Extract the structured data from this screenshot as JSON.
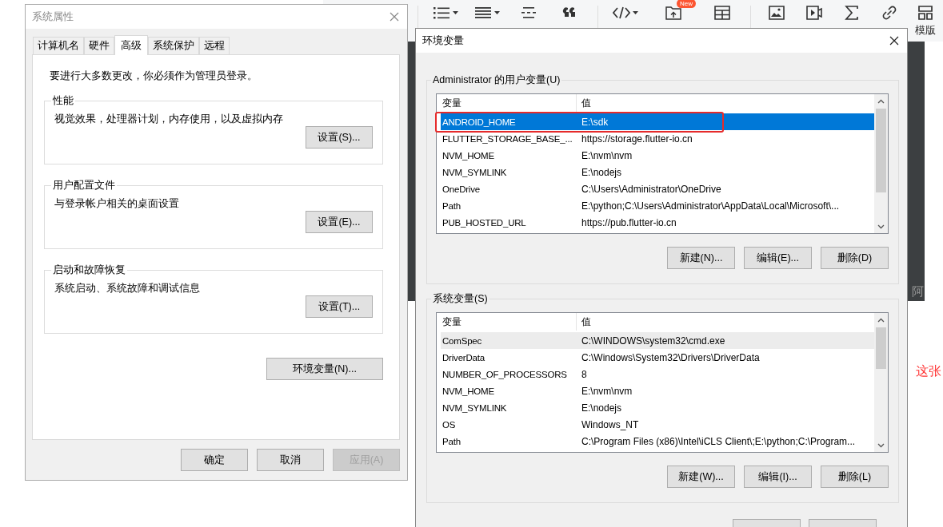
{
  "editor_toolbar": {
    "tools": [
      {
        "kind": "list",
        "dropdown": true,
        "divider_before": true
      },
      {
        "kind": "align",
        "dropdown": true,
        "divider_before": false
      },
      {
        "kind": "rule",
        "dropdown": false,
        "divider_before": false
      },
      {
        "kind": "quote",
        "dropdown": false,
        "divider_before": false
      },
      {
        "kind": "code",
        "dropdown": true,
        "divider_before": true
      },
      {
        "kind": "upload",
        "dropdown": false,
        "divider_before": false,
        "badge": "New"
      },
      {
        "kind": "table",
        "dropdown": false,
        "divider_before": false
      },
      {
        "kind": "image",
        "dropdown": false,
        "divider_before": true
      },
      {
        "kind": "video",
        "dropdown": false,
        "divider_before": false
      },
      {
        "kind": "formula",
        "dropdown": false,
        "divider_before": false
      },
      {
        "kind": "link",
        "dropdown": false,
        "divider_before": false
      },
      {
        "kind": "template",
        "dropdown": false,
        "divider_before": false,
        "label": "模版"
      }
    ]
  },
  "article": {
    "image_fragment": "阿",
    "text_fragment": "这张"
  },
  "system_properties": {
    "title": "系统属性",
    "tabs": [
      {
        "label": "计算机名",
        "selected": false
      },
      {
        "label": "硬件",
        "selected": false
      },
      {
        "label": "高级",
        "selected": true
      },
      {
        "label": "系统保护",
        "selected": false
      },
      {
        "label": "远程",
        "selected": false
      }
    ],
    "notice": "要进行大多数更改，你必须作为管理员登录。",
    "groups": [
      {
        "title": "性能",
        "description": "视觉效果，处理器计划，内存使用，以及虚拟内存",
        "button": "设置(S)..."
      },
      {
        "title": "用户配置文件",
        "description": "与登录帐户相关的桌面设置",
        "button": "设置(E)..."
      },
      {
        "title": "启动和故障恢复",
        "description": "系统启动、系统故障和调试信息",
        "button": "设置(T)..."
      }
    ],
    "env_button": "环境变量(N)...",
    "buttons": [
      {
        "label": "确定",
        "disabled": false
      },
      {
        "label": "取消",
        "disabled": false
      },
      {
        "label": "应用(A)",
        "disabled": true
      }
    ]
  },
  "environment_variables": {
    "title": "环境变量",
    "sections": [
      {
        "title": "Administrator 的用户变量(U)",
        "columns": [
          "变量",
          "值"
        ],
        "rows": [
          {
            "name": "ANDROID_HOME",
            "value": "E:\\sdk",
            "selected": true,
            "hovered": false,
            "annotated": true
          },
          {
            "name": "FLUTTER_STORAGE_BASE_...",
            "value": "https://storage.flutter-io.cn",
            "selected": false,
            "hovered": false,
            "annotated": false
          },
          {
            "name": "NVM_HOME",
            "value": "E:\\nvm\\nvm",
            "selected": false,
            "hovered": false,
            "annotated": false
          },
          {
            "name": "NVM_SYMLINK",
            "value": "E:\\nodejs",
            "selected": false,
            "hovered": false,
            "annotated": false
          },
          {
            "name": "OneDrive",
            "value": "C:\\Users\\Administrator\\OneDrive",
            "selected": false,
            "hovered": false,
            "annotated": false
          },
          {
            "name": "Path",
            "value": "E:\\python;C:\\Users\\Administrator\\AppData\\Local\\Microsoft\\...",
            "selected": false,
            "hovered": false,
            "annotated": false
          },
          {
            "name": "PUB_HOSTED_URL",
            "value": "https://pub.flutter-io.cn",
            "selected": false,
            "hovered": false,
            "annotated": false
          }
        ],
        "buttons": [
          "新建(N)...",
          "编辑(E)...",
          "删除(D)"
        ]
      },
      {
        "title": "系统变量(S)",
        "columns": [
          "变量",
          "值"
        ],
        "rows": [
          {
            "name": "ComSpec",
            "value": "C:\\WINDOWS\\system32\\cmd.exe",
            "selected": false,
            "hovered": true,
            "annotated": false
          },
          {
            "name": "DriverData",
            "value": "C:\\Windows\\System32\\Drivers\\DriverData",
            "selected": false,
            "hovered": false,
            "annotated": false
          },
          {
            "name": "NUMBER_OF_PROCESSORS",
            "value": "8",
            "selected": false,
            "hovered": false,
            "annotated": false
          },
          {
            "name": "NVM_HOME",
            "value": "E:\\nvm\\nvm",
            "selected": false,
            "hovered": false,
            "annotated": false
          },
          {
            "name": "NVM_SYMLINK",
            "value": "E:\\nodejs",
            "selected": false,
            "hovered": false,
            "annotated": false
          },
          {
            "name": "OS",
            "value": "Windows_NT",
            "selected": false,
            "hovered": false,
            "annotated": false
          },
          {
            "name": "Path",
            "value": "C:\\Program Files (x86)\\Intel\\iCLS Client\\;E:\\python;C:\\Program...",
            "selected": false,
            "hovered": false,
            "annotated": false
          }
        ],
        "buttons": [
          "新建(W)...",
          "编辑(I)...",
          "删除(L)"
        ]
      }
    ]
  }
}
